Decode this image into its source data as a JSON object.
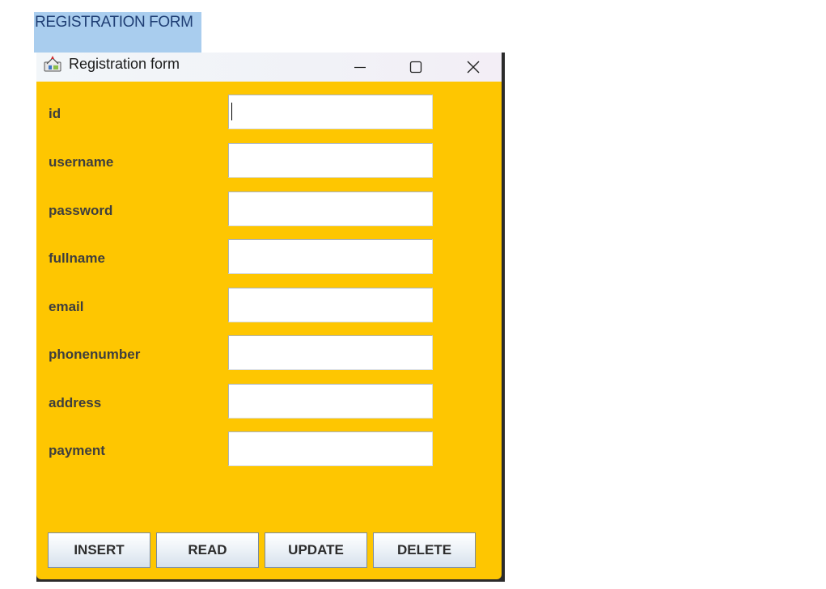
{
  "document": {
    "heading": "REGISTRATION FORM"
  },
  "window": {
    "title": "Registration form",
    "app_icon": "java-cup-icon",
    "controls": {
      "minimize_icon": "minimize-icon",
      "maximize_icon": "maximize-icon",
      "close_icon": "close-icon"
    }
  },
  "form": {
    "background_color": "#fec601",
    "fields": [
      {
        "label": "id",
        "value": ""
      },
      {
        "label": "username",
        "value": ""
      },
      {
        "label": "password",
        "value": ""
      },
      {
        "label": "fullname",
        "value": ""
      },
      {
        "label": "email",
        "value": ""
      },
      {
        "label": "phonenumber",
        "value": ""
      },
      {
        "label": "address",
        "value": ""
      },
      {
        "label": "payment",
        "value": ""
      }
    ],
    "buttons": {
      "insert": "INSERT",
      "read": "READ",
      "update": "UPDATE",
      "delete": "DELETE"
    }
  }
}
